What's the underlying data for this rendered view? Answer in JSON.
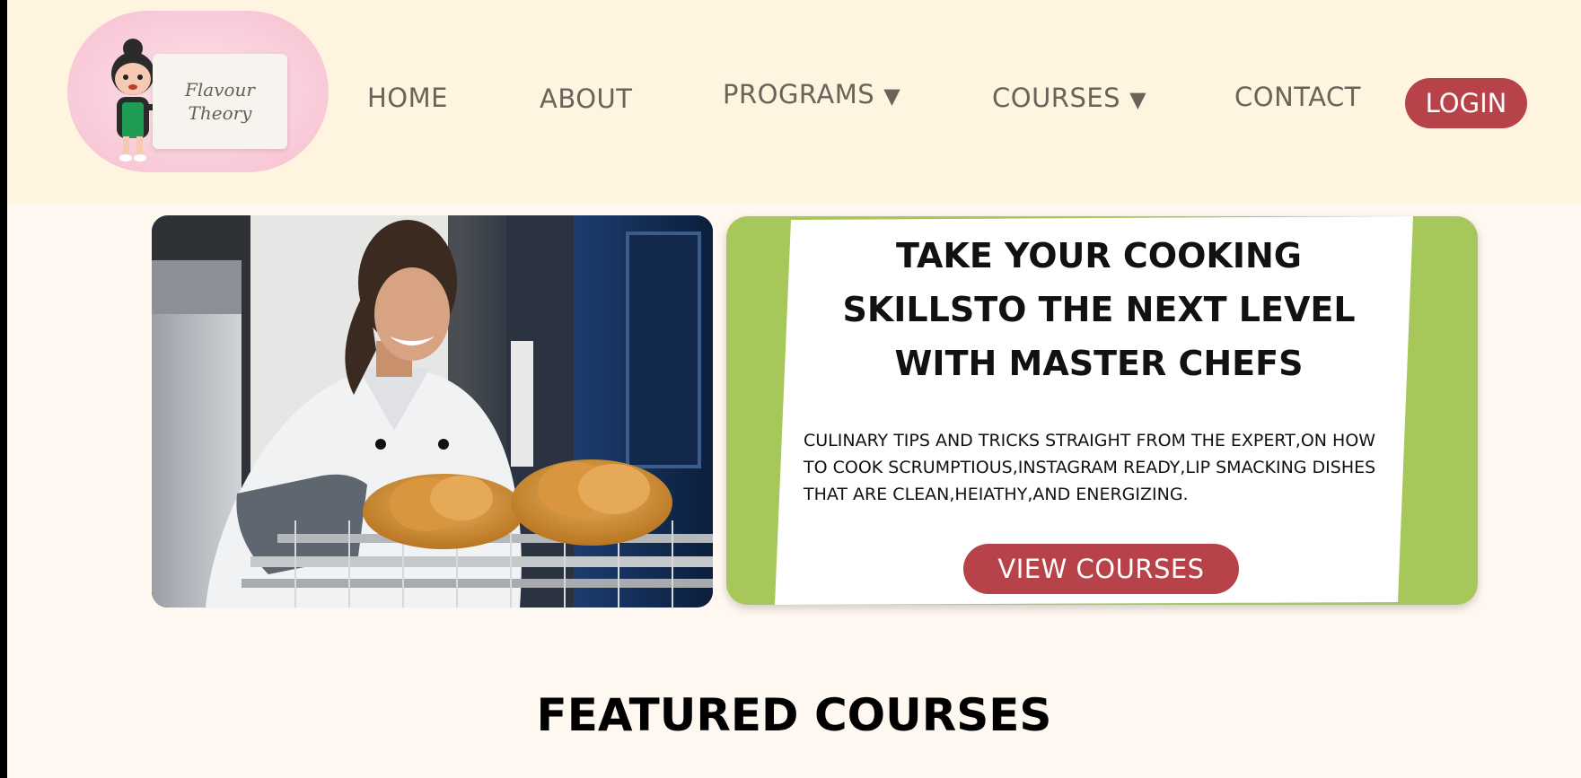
{
  "brand": {
    "logo_line1": "Flavour",
    "logo_line2": "Theory"
  },
  "nav": {
    "home": "HOME",
    "about": "ABOUT",
    "programs": "PROGRAMS",
    "courses": "COURSES",
    "contact": "CONTACT",
    "login": "LOGIN",
    "dropdown_arrow": "▼"
  },
  "hero": {
    "image_icon": "chef-baking-croissants-photo",
    "title": "TAKE YOUR COOKING SKILLSTO THE NEXT LEVEL WITH MASTER CHEFS",
    "description": "CULINARY TIPS AND TRICKS STRAIGHT FROM THE EXPERT,ON HOW TO COOK SCRUMPTIOUS,INSTAGRAM READY,LIP SMACKING DISHES THAT ARE CLEAN,HEIATHY,AND ENERGIZING.",
    "cta": "VIEW COURSES"
  },
  "featured": {
    "heading": "FEATURED COURSES"
  },
  "colors": {
    "header_bg": "#fff4e0",
    "page_bg": "#fff8f0",
    "accent": "#b7424a",
    "card_green": "#a6c85a",
    "logo_pink": "#f9cad8"
  }
}
